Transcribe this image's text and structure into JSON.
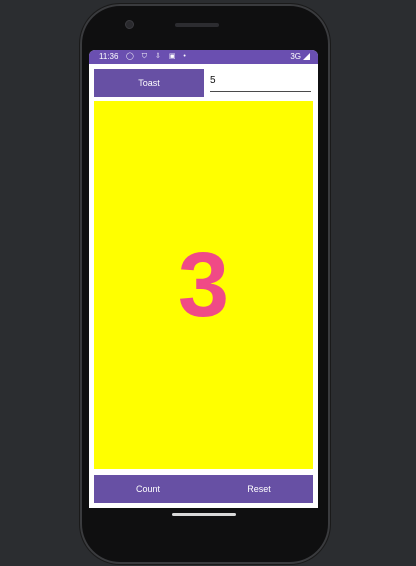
{
  "status_bar": {
    "time": "11:36",
    "icons": [
      "circle-icon",
      "shield-icon",
      "download-icon",
      "lock-icon",
      "dot-icon"
    ],
    "network": "3G"
  },
  "toolbar": {
    "toast_label": "Toast",
    "input_value": "5"
  },
  "counter": {
    "value": "3"
  },
  "bottom": {
    "count_label": "Count",
    "reset_label": "Reset"
  },
  "colors": {
    "accent": "#6750a4",
    "status_bar": "#6a4fb0",
    "panel": "#ffff00",
    "count_text": "#f04a86"
  }
}
